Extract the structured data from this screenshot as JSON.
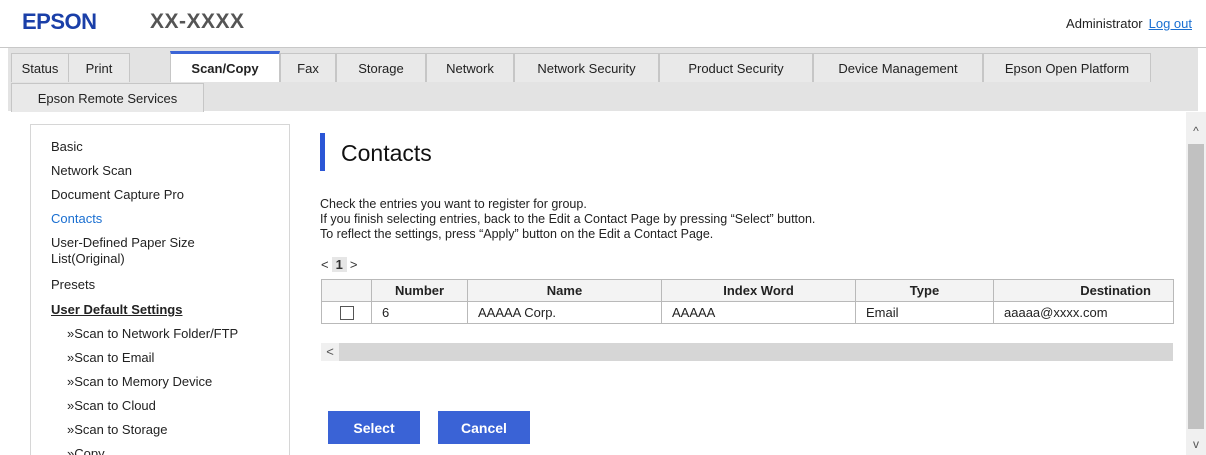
{
  "header": {
    "logo": "EPSON",
    "model": "XX-XXXX",
    "user": "Administrator",
    "logout_label": "Log out"
  },
  "tabs": [
    {
      "label": "Status"
    },
    {
      "label": "Print"
    },
    {
      "label": "Scan/Copy",
      "active": true
    },
    {
      "label": "Fax"
    },
    {
      "label": "Storage"
    },
    {
      "label": "Network"
    },
    {
      "label": "Network Security"
    },
    {
      "label": "Product Security"
    },
    {
      "label": "Device Management"
    },
    {
      "label": "Epson Open Platform"
    },
    {
      "label": "Epson Remote Services"
    }
  ],
  "sidebar": {
    "items": [
      {
        "label": "Basic"
      },
      {
        "label": "Network Scan"
      },
      {
        "label": "Document Capture Pro"
      },
      {
        "label": "Contacts",
        "selected": true
      },
      {
        "label": "User-Defined Paper Size"
      },
      {
        "label": "List(Original)"
      },
      {
        "label": "Presets"
      },
      {
        "label": "User Default Settings"
      },
      {
        "label": "»Scan to Network Folder/FTP"
      },
      {
        "label": "»Scan to Email"
      },
      {
        "label": "»Scan to Memory Device"
      },
      {
        "label": "»Scan to Cloud"
      },
      {
        "label": "»Scan to Storage"
      },
      {
        "label": "»Copy"
      }
    ]
  },
  "main": {
    "title": "Contacts",
    "instructions": [
      "Check the entries you want to register for group.",
      "If you finish selecting entries, back to the Edit a Contact Page by pressing “Select” button.",
      "To reflect the settings, press “Apply” button on the Edit a Contact Page."
    ],
    "pager": {
      "prev": "<",
      "current": "1",
      "next": ">"
    },
    "table": {
      "columns": [
        "Number",
        "Name",
        "Index Word",
        "Type",
        "Destination"
      ],
      "rows": [
        {
          "checked": false,
          "cells": [
            "6",
            "AAAAA Corp.",
            "AAAAA",
            "Email",
            "aaaaa@xxxx.com"
          ]
        }
      ]
    },
    "hscroll_left": "<",
    "select_label": "Select",
    "cancel_label": "Cancel"
  },
  "scrollbar": {
    "up": "^",
    "down": "v"
  },
  "colors": {
    "brand": "#1a3fa8",
    "accent": "#3a63d6",
    "link": "#1a6fd1"
  }
}
